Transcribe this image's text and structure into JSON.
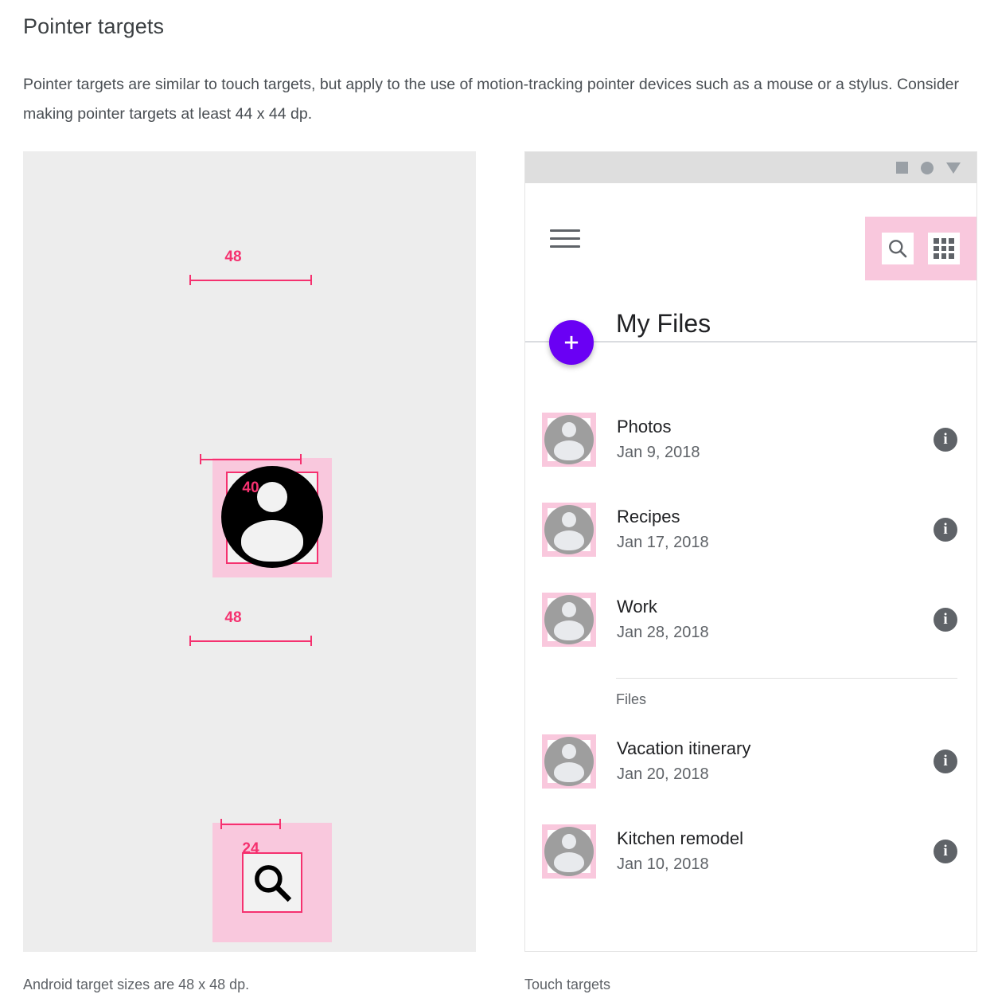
{
  "page": {
    "title": "Pointer targets",
    "body": "Pointer targets are similar to touch targets, but apply to the use of motion-tracking pointer devices such as a mouse or a stylus. Consider making pointer targets at least 44 x 44 dp."
  },
  "captions": {
    "left": "Android target sizes are 48 x 48 dp.",
    "right": "Touch targets"
  },
  "colors": {
    "highlight_fill": "#f9c8dd",
    "annotation": "#f5316f",
    "fab": "#6a00f4",
    "panel_bg": "#ededed",
    "icon_gray": "#5f6368"
  },
  "spec_diagram": {
    "avatar": {
      "outer_label": "48",
      "inner_label": "40"
    },
    "search": {
      "outer_label": "48",
      "inner_label": "24"
    }
  },
  "phone": {
    "status_bar": {
      "nav_square": "square-nav-icon",
      "nav_circle": "circle-nav-icon",
      "nav_triangle": "triangle-nav-icon"
    },
    "app_bar": {
      "menu_icon": "hamburger-menu-icon",
      "search_icon": "search-icon",
      "grid_icon": "grid-view-icon",
      "title": "My Files",
      "fab_label": "+"
    },
    "section_label": "Files",
    "folders": [
      {
        "name": "Photos",
        "date": "Jan 9, 2018",
        "info": "i"
      },
      {
        "name": "Recipes",
        "date": "Jan 17, 2018",
        "info": "i"
      },
      {
        "name": "Work",
        "date": "Jan 28, 2018",
        "info": "i"
      }
    ],
    "files": [
      {
        "name": "Vacation itinerary",
        "date": "Jan 20, 2018",
        "info": "i"
      },
      {
        "name": "Kitchen remodel",
        "date": "Jan 10, 2018",
        "info": "i"
      }
    ]
  }
}
